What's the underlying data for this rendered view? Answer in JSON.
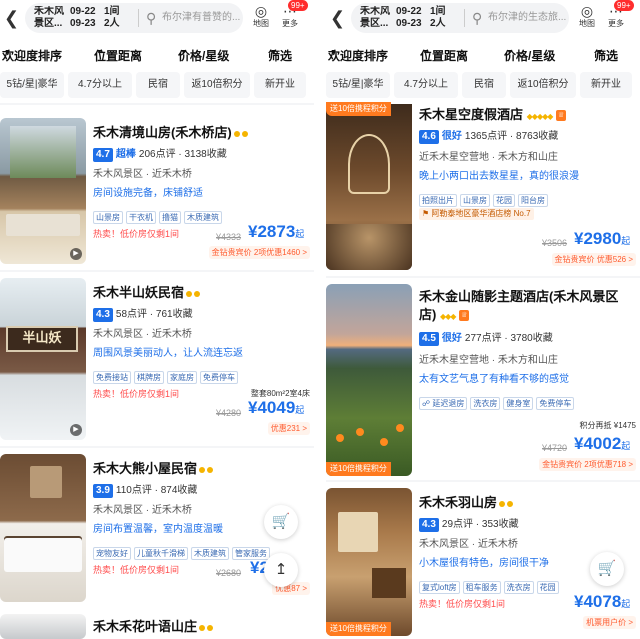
{
  "accent_color": "#1e6fe8",
  "hot_color": "#ff4d4d",
  "left": {
    "header": {
      "city": "禾木风景区...",
      "checkin": "09-22",
      "checkout": "09-23",
      "rooms": "1间",
      "guests": "2人",
      "search_placeholder": "布尔津有普赞的...",
      "map_label": "地图",
      "more_label": "更多",
      "badge": "99+"
    },
    "sort": [
      "欢迎度排序",
      "位置距离",
      "价格/星级",
      "筛选"
    ],
    "chips": [
      "5钻/星|豪华",
      "4.7分以上",
      "民宿",
      "返10倍积分",
      "新开业"
    ],
    "hotels": [
      {
        "name": "禾木清境山房(禾木桥店)",
        "score": "4.7",
        "level": "超棒",
        "reviews": "206点评",
        "favorites": "3138收藏",
        "location": "禾木风景区 · 近禾木桥",
        "highlight": "房间设施完备，床铺舒适",
        "tags": [
          "山景房",
          "干衣机",
          "撸猫",
          "木质建筑"
        ],
        "hot": "热卖！低价房仅剩1间",
        "original": "¥4333",
        "price": "¥2873",
        "price_suffix": "起",
        "promo": "金钻贵宾价  2项优惠1460 >"
      },
      {
        "name": "禾木半山妖民宿",
        "score": "4.3",
        "reviews": "58点评",
        "favorites": "761收藏",
        "location": "禾木风景区 · 近禾木桥",
        "highlight": "周围风景美丽动人，让人流连忘返",
        "tags": [
          "免费接站",
          "棋牌房",
          "家庭房",
          "免费停车"
        ],
        "hot": "热卖！低价房仅剩1间",
        "side": "整套80m²2室4床",
        "original": "¥4280",
        "price": "¥4049",
        "price_suffix": "起",
        "promo": "优惠231 >",
        "sign_text": "半山妖"
      },
      {
        "name": "禾木大熊小屋民宿",
        "score": "3.9",
        "reviews": "110点评",
        "favorites": "874收藏",
        "location": "禾木风景区 · 近禾木桥",
        "highlight": "房间布置温馨，室内温度温暖",
        "tags": [
          "宠物友好",
          "儿童秋千滑梯",
          "木质建筑",
          "管家服务"
        ],
        "hot": "热卖！低价房仅剩1间",
        "original": "¥2680",
        "price": "¥2",
        "promo": "优惠87 >"
      },
      {
        "name": "禾木禾花叶语山庄"
      }
    ],
    "cart_icon": "cart-icon",
    "top_icon": "back-to-top-icon"
  },
  "right": {
    "header": {
      "city": "禾木风景区...",
      "checkin": "09-22",
      "checkout": "09-23",
      "rooms": "1间",
      "guests": "2人",
      "search_placeholder": "布尔津的生态旅...",
      "map_label": "地图",
      "more_label": "更多",
      "badge": "99+"
    },
    "sort": [
      "欢迎度排序",
      "位置距离",
      "价格/星级",
      "筛选"
    ],
    "chips": [
      "5钻/星|豪华",
      "4.7分以上",
      "民宿",
      "返10倍积分",
      "新开业"
    ],
    "hotels": [
      {
        "name": "禾木星空度假酒店",
        "score": "4.6",
        "level": "很好",
        "reviews": "1365点评",
        "favorites": "8763收藏",
        "location": "近禾木星空营地 · 禾木方和山庄",
        "highlight": "晚上小两口出去数星星，真的很浪漫",
        "tags": [
          "拍照出片",
          "山景房",
          "花园",
          "阳台房"
        ],
        "rank": "阿勒泰地区豪华酒店榜 No.7",
        "original": "¥3506",
        "price": "¥2980",
        "price_suffix": "起",
        "promo": "金钻贵宾价  优惠526 >"
      },
      {
        "name": "禾木金山随影主题酒店(禾木风景区店)",
        "score": "4.5",
        "level": "很好",
        "reviews": "277点评",
        "favorites": "3780收藏",
        "location": "近禾木星空营地 · 禾木方和山庄",
        "highlight": "太有文艺气息了有种看不够的感觉",
        "tags": [
          "延迟退房",
          "洗衣房",
          "健身室",
          "免费停车"
        ],
        "points": "积分再抵 ¥1475",
        "original": "¥4720",
        "price": "¥4002",
        "price_suffix": "起",
        "promo": "金钻贵宾价  2项优惠718 >",
        "photo_tag": "送10倍携程积分"
      },
      {
        "name": "禾木禾羽山房",
        "score": "4.3",
        "reviews": "29点评",
        "favorites": "353收藏",
        "location": "禾木风景区 · 近禾木桥",
        "highlight": "小木屋很有特色，房间很干净",
        "tags": [
          "复式loft房",
          "租车服务",
          "洗衣房",
          "花园"
        ],
        "hot": "热卖！低价房仅剩1间",
        "price": "¥4078",
        "price_suffix": "起",
        "promo": "机票用户价 >",
        "photo_tag": "送10倍携程积分"
      }
    ],
    "top_photo_tag": "送10倍携程积分",
    "cart_icon": "cart-icon"
  }
}
